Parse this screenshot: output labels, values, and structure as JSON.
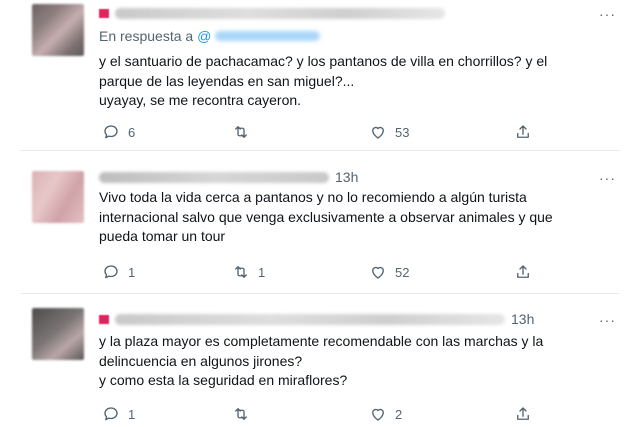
{
  "tweets": [
    {
      "time": "",
      "reply_prefix": "En respuesta a",
      "reply_handle": "@",
      "text": "y el santuario de pachacamac? y los pantanos de villa en chorrillos? y el\nparque de las leyendas en san miguel?...\nuyayay, se me recontra cayeron.",
      "more": "···",
      "replies": "6",
      "retweets": "",
      "likes": "53",
      "icons": [
        "reply-icon",
        "retweet-icon",
        "like-icon",
        "share-icon"
      ]
    },
    {
      "time": "13h",
      "text": "Vivo toda la vida cerca a pantanos y no lo recomiendo a algún turista\ninternacional salvo que venga exclusivamente a observar animales y que\npueda tomar un tour",
      "more": "···",
      "replies": "1",
      "retweets": "1",
      "likes": "52",
      "icons": [
        "reply-icon",
        "retweet-icon",
        "like-icon",
        "share-icon"
      ]
    },
    {
      "time": "13h",
      "text": "y la plaza mayor es completamente recomendable con las marchas y la\ndelincuencia en algunos jirones?\ny como esta la seguridad en miraflores?",
      "more": "···",
      "replies": "1",
      "retweets": "",
      "likes": "2",
      "icons": [
        "reply-icon",
        "retweet-icon",
        "like-icon",
        "share-icon"
      ]
    }
  ],
  "colors": {
    "text": "#0f1419",
    "muted": "#536471",
    "link": "#1d9bf0",
    "border": "#e6ecf0",
    "brand_red": "#e0245e"
  }
}
